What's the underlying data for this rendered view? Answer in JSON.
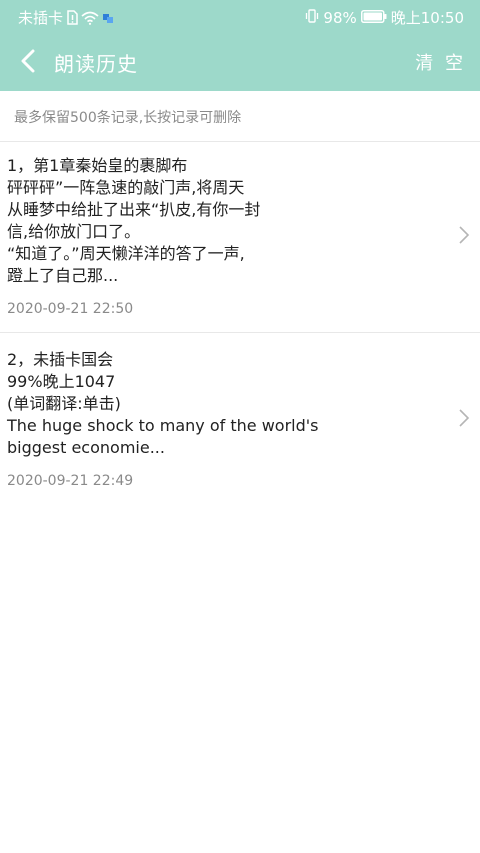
{
  "status_bar": {
    "carrier": "未插卡",
    "battery": "98%",
    "time": "晚上10:50"
  },
  "header": {
    "title": "朗读历史",
    "clear_label": "清 空",
    "color": "#9dd9ca"
  },
  "hint": "最多保留500条记录,长按记录可删除",
  "items": [
    {
      "text": "1，第1章秦始皇的裹脚布\n砰砰砰”一阵急速的敲门声,将周天\n从睡梦中给扯了出来“扒皮,有你一封\n信,给你放门口了。\n“知道了。”周天懒洋洋的答了一声,\n蹬上了自己那...",
      "date": "2020-09-21 22:50"
    },
    {
      "text": "2，未插卡国会\n99%晚上1047\n(单词翻译:单击)\nThe huge shock to many of the world's\nbiggest economie...",
      "date": "2020-09-21 22:49"
    }
  ]
}
